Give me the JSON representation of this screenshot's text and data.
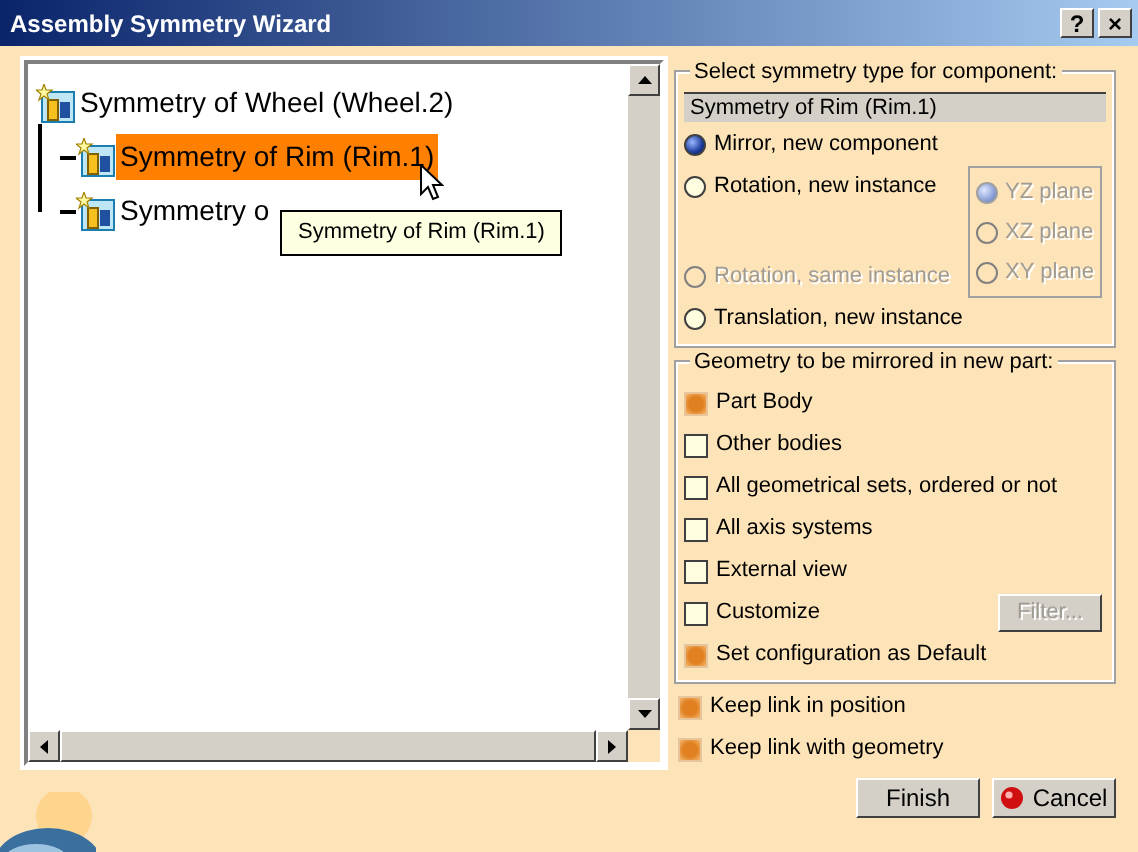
{
  "window": {
    "title": "Assembly Symmetry Wizard",
    "help": "?",
    "close": "×"
  },
  "tree": {
    "items": [
      {
        "label": "Symmetry of Wheel (Wheel.2)",
        "selected": false,
        "children": [
          {
            "label": "Symmetry of Rim (Rim.1)",
            "selected": true
          },
          {
            "label": "Symmetry o",
            "selected": false
          }
        ]
      }
    ]
  },
  "tooltip": "Symmetry of Rim (Rim.1)",
  "symmetry_type": {
    "legend": "Select symmetry type for component:",
    "component": "Symmetry of Rim (Rim.1)",
    "options": [
      {
        "label": "Mirror, new component",
        "selected": true,
        "disabled": false
      },
      {
        "label": "Rotation, new instance",
        "selected": false,
        "disabled": false
      },
      {
        "label": "Rotation, same instance",
        "selected": false,
        "disabled": true
      },
      {
        "label": "Translation, new instance",
        "selected": false,
        "disabled": false
      }
    ],
    "planes": [
      {
        "label": "YZ plane",
        "selected": true,
        "disabled": true
      },
      {
        "label": "XZ plane",
        "selected": false,
        "disabled": true
      },
      {
        "label": "XY plane",
        "selected": false,
        "disabled": true
      }
    ]
  },
  "geometry": {
    "legend": "Geometry to be mirrored in new part:",
    "options": [
      {
        "label": "Part Body",
        "checked": true
      },
      {
        "label": "Other bodies",
        "checked": false
      },
      {
        "label": "All geometrical sets, ordered or not",
        "checked": false
      },
      {
        "label": "All axis systems",
        "checked": false
      },
      {
        "label": "External view",
        "checked": false
      },
      {
        "label": "Customize",
        "checked": false,
        "button": {
          "label": "Filter...",
          "disabled": true
        }
      },
      {
        "label": "Set configuration as Default",
        "checked": true
      }
    ]
  },
  "links": [
    {
      "label": "Keep link in position",
      "checked": true
    },
    {
      "label": "Keep link with geometry",
      "checked": true
    }
  ],
  "buttons": [
    {
      "label": "Finish",
      "kind": "plain"
    },
    {
      "label": "Cancel",
      "kind": "cancel"
    }
  ]
}
